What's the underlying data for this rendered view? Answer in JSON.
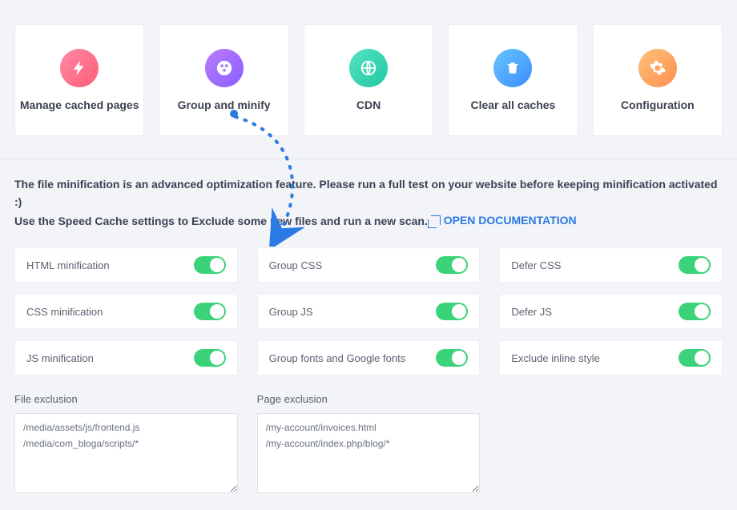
{
  "nav": [
    {
      "label": "Manage cached pages",
      "icon": "bolt",
      "grad": "pink"
    },
    {
      "label": "Group and minify",
      "icon": "circle",
      "grad": "purple"
    },
    {
      "label": "CDN",
      "icon": "globe",
      "grad": "teal"
    },
    {
      "label": "Clear all caches",
      "icon": "trash",
      "grad": "blue"
    },
    {
      "label": "Configuration",
      "icon": "gear",
      "grad": "orange"
    }
  ],
  "intro": {
    "line1": "The file minification is an advanced optimization feature. Please run a full test on your website before keeping minification activated :)",
    "line2_prefix": "Use the Speed Cache settings to Exclude some new files and run a new scan.",
    "doc_link": "OPEN DOCUMENTATION"
  },
  "toggles": [
    [
      {
        "label": "HTML minification",
        "on": true
      },
      {
        "label": "Group CSS",
        "on": true
      },
      {
        "label": "Defer CSS",
        "on": true
      }
    ],
    [
      {
        "label": "CSS minification",
        "on": true
      },
      {
        "label": "Group JS",
        "on": true
      },
      {
        "label": "Defer JS",
        "on": true
      }
    ],
    [
      {
        "label": "JS minification",
        "on": true
      },
      {
        "label": "Group fonts and Google fonts",
        "on": true
      },
      {
        "label": "Exclude inline style",
        "on": true
      }
    ]
  ],
  "exclusions": {
    "file": {
      "label": "File exclusion",
      "value": "/media/assets/js/frontend.js\n/media/com_bloga/scripts/*"
    },
    "page": {
      "label": "Page exclusion",
      "value": "/my-account/invoices.html\n/my-account/index.php/blog/*"
    }
  }
}
